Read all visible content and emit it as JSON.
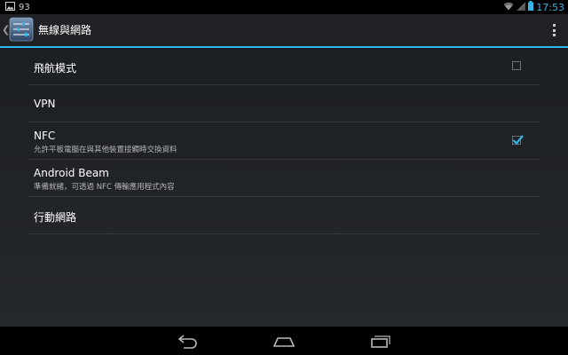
{
  "status_bar": {
    "notification_count": "93",
    "time": "17:53",
    "icons": [
      "image-notification-icon",
      "wifi-icon",
      "signal-icon",
      "battery-icon"
    ]
  },
  "action_bar": {
    "title": "無線與網路",
    "app_icon": "settings-sliders-icon",
    "overflow_icon": "overflow-menu-icon"
  },
  "settings": [
    {
      "id": "airplane",
      "title": "飛航模式",
      "summary": "",
      "checkbox": true,
      "checked": false
    },
    {
      "id": "vpn",
      "title": "VPN",
      "summary": "",
      "checkbox": false,
      "checked": false
    },
    {
      "id": "nfc",
      "title": "NFC",
      "summary": "允許平板電腦在與其他裝置接觸時交換資料",
      "checkbox": true,
      "checked": true
    },
    {
      "id": "android-beam",
      "title": "Android Beam",
      "summary": "準備就緒，可透過 NFC 傳輸應用程式內容",
      "checkbox": false,
      "checked": false
    },
    {
      "id": "mobile-network",
      "title": "行動網路",
      "summary": "",
      "checkbox": false,
      "checked": false
    }
  ],
  "nav_bar": {
    "buttons": [
      "back-icon",
      "home-icon",
      "recents-icon"
    ]
  },
  "colors": {
    "accent": "#33b5e5",
    "background": "#202327",
    "divider": "#34373b",
    "text_primary": "#ffffff",
    "text_secondary": "#b4b4b4"
  }
}
